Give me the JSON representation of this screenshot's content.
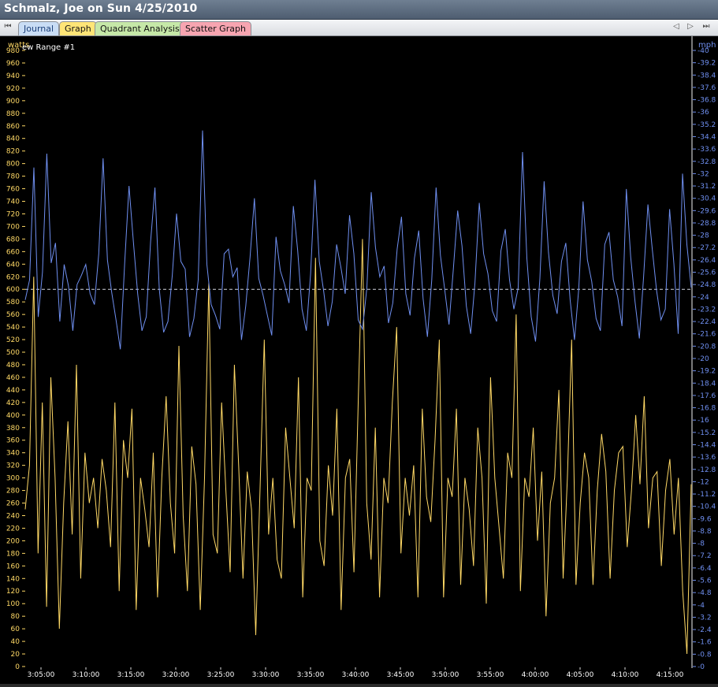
{
  "window": {
    "title": "Schmalz, Joe on Sun 4/25/2010"
  },
  "tabs": [
    {
      "label": "Journal",
      "color": "#c9ddf5"
    },
    {
      "label": "Graph",
      "color": "#ffe577"
    },
    {
      "label": "Quadrant Analysis",
      "color": "#c6e8a8"
    },
    {
      "label": "Scatter Graph",
      "color": "#f7a5b1"
    }
  ],
  "nav": {
    "first": "⏮",
    "prev": "◁",
    "next": "▷",
    "last": "⏭"
  },
  "chart_data": {
    "type": "line",
    "range_label": "ew Range #1",
    "y_left": {
      "label": "watts",
      "min": 0,
      "max": 980,
      "step": 20,
      "color": "#ffd966"
    },
    "y_right": {
      "label": "mph",
      "min": 0,
      "max": 40,
      "step": 0.8,
      "color": "#6f8ff0"
    },
    "x_ticks": [
      "3:05:00",
      "3:10:00",
      "3:15:00",
      "3:20:00",
      "3:25:00",
      "3:30:00",
      "3:35:00",
      "3:40:00",
      "3:45:00",
      "3:50:00",
      "3:55:00",
      "4:00:00",
      "4:05:00",
      "4:10:00",
      "4:15:00"
    ],
    "reference_line": {
      "axis": "watts",
      "value": 600
    },
    "series": [
      {
        "name": "watts",
        "axis": "left",
        "color": "#ffd966",
        "values": [
          250,
          320,
          620,
          180,
          420,
          95,
          460,
          300,
          60,
          260,
          390,
          210,
          480,
          140,
          340,
          260,
          300,
          220,
          330,
          280,
          190,
          420,
          120,
          360,
          300,
          410,
          90,
          300,
          250,
          190,
          340,
          110,
          300,
          430,
          260,
          180,
          510,
          240,
          120,
          350,
          290,
          90,
          300,
          610,
          210,
          180,
          420,
          280,
          150,
          480,
          320,
          140,
          310,
          250,
          50,
          280,
          520,
          210,
          300,
          170,
          140,
          380,
          300,
          220,
          460,
          110,
          300,
          280,
          650,
          200,
          160,
          320,
          240,
          410,
          90,
          300,
          330,
          150,
          420,
          680,
          260,
          170,
          380,
          110,
          300,
          260,
          420,
          540,
          180,
          300,
          240,
          320,
          110,
          410,
          270,
          230,
          360,
          520,
          110,
          300,
          270,
          410,
          130,
          300,
          250,
          160,
          380,
          300,
          100,
          460,
          300,
          220,
          140,
          340,
          300,
          560,
          120,
          300,
          270,
          380,
          200,
          310,
          80,
          260,
          300,
          440,
          140,
          300,
          520,
          130,
          260,
          340,
          300,
          130,
          280,
          370,
          310,
          140,
          280,
          340,
          350,
          190,
          280,
          400,
          290,
          430,
          220,
          300,
          310,
          160,
          280,
          330,
          210,
          300,
          120,
          20,
          290
        ]
      },
      {
        "name": "mph",
        "axis": "right",
        "color": "#6f8ff0",
        "values": [
          23.8,
          25.1,
          32.4,
          22.7,
          25.6,
          33.3,
          26.2,
          27.5,
          22.4,
          26.1,
          24.7,
          21.8,
          24.8,
          25.4,
          26.1,
          24.2,
          23.5,
          26.8,
          33.0,
          26.4,
          24.3,
          22.5,
          20.6,
          26.2,
          31.2,
          27.6,
          24.2,
          21.8,
          22.7,
          27.6,
          31.1,
          24.5,
          21.7,
          22.4,
          25.4,
          29.4,
          26.3,
          25.8,
          21.4,
          22.6,
          25.1,
          34.8,
          26.1,
          23.5,
          22.8,
          21.9,
          26.8,
          27.1,
          25.3,
          25.9,
          21.2,
          23.4,
          26.6,
          30.4,
          25.2,
          24.1,
          22.8,
          21.5,
          27.9,
          25.7,
          24.8,
          23.6,
          29.9,
          27.0,
          23.2,
          21.8,
          25.5,
          31.6,
          26.3,
          24.4,
          22.1,
          23.7,
          27.4,
          25.9,
          24.2,
          29.3,
          26.8,
          22.5,
          21.9,
          24.6,
          30.8,
          27.2,
          25.3,
          26.0,
          22.3,
          23.6,
          27.1,
          29.2,
          24.2,
          22.8,
          26.5,
          28.3,
          23.9,
          21.4,
          25.1,
          31.1,
          26.7,
          24.5,
          22.2,
          25.8,
          29.6,
          27.3,
          23.4,
          21.6,
          24.9,
          30.1,
          26.8,
          25.5,
          23.1,
          22.4,
          27.0,
          28.4,
          25.1,
          23.2,
          24.6,
          33.4,
          26.5,
          22.7,
          21.1,
          25.2,
          31.5,
          26.9,
          24.1,
          22.9,
          26.3,
          27.5,
          23.8,
          21.2,
          24.5,
          30.2,
          26.4,
          25.0,
          22.6,
          21.8,
          27.4,
          28.2,
          25.1,
          24.0,
          22.1,
          31.0,
          26.6,
          23.7,
          21.3,
          25.3,
          30.0,
          27.1,
          24.4,
          22.5,
          23.2,
          29.7,
          26.1,
          21.6,
          32.0,
          27.4,
          24.6
        ]
      }
    ]
  }
}
